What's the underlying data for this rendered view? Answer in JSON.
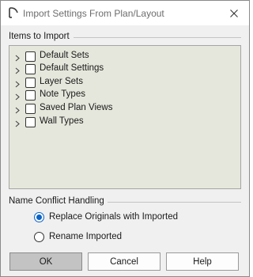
{
  "window": {
    "title": "Import Settings From Plan/Layout",
    "close_label": "×"
  },
  "items_section": {
    "label": "Items to Import",
    "items": [
      {
        "label": "Default Sets",
        "checked": false,
        "expanded": false
      },
      {
        "label": "Default Settings",
        "checked": false,
        "expanded": false
      },
      {
        "label": "Layer Sets",
        "checked": false,
        "expanded": false
      },
      {
        "label": "Note Types",
        "checked": false,
        "expanded": false
      },
      {
        "label": "Saved Plan Views",
        "checked": false,
        "expanded": false
      },
      {
        "label": "Wall Types",
        "checked": false,
        "expanded": false
      }
    ]
  },
  "conflict_section": {
    "label": "Name Conflict Handling",
    "options": [
      {
        "label": "Replace Originals with Imported",
        "selected": true
      },
      {
        "label": "Rename Imported",
        "selected": false
      }
    ]
  },
  "buttons": {
    "ok": "OK",
    "cancel": "Cancel",
    "help": "Help"
  },
  "colors": {
    "accent": "#0a63c8",
    "tree_background": "#e6e7dc",
    "dialog_background": "#f0f0f0"
  }
}
